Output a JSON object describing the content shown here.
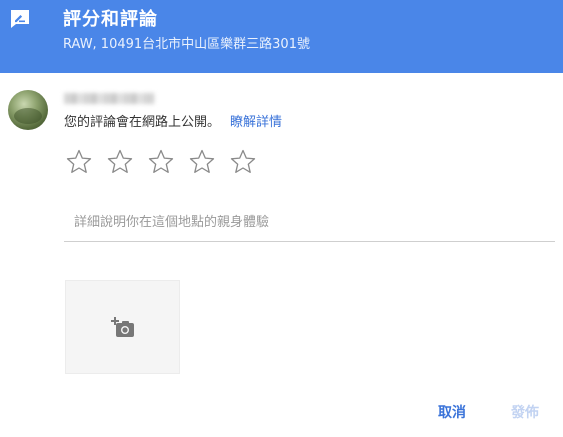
{
  "header": {
    "icon": "rate-review-icon",
    "title": "評分和評論",
    "address": "RAW, 10491台北市中山區樂群三路301號"
  },
  "user": {
    "avatar": "avatar",
    "name": "██████ ████"
  },
  "notice": {
    "text": "您的評論會在網路上公開。",
    "learn_more": "瞭解詳情"
  },
  "rating": {
    "max": 5,
    "selected": 0,
    "icon": "star-outline-icon"
  },
  "review": {
    "placeholder": "詳細說明你在這個地點的親身體驗",
    "value": ""
  },
  "photo": {
    "icon": "add-photo-icon"
  },
  "actions": {
    "cancel_label": "取消",
    "post_label": "發佈"
  },
  "colors": {
    "header_bg": "#4a86e8",
    "link": "#3a73d9",
    "disabled": "#c2d3f2"
  }
}
